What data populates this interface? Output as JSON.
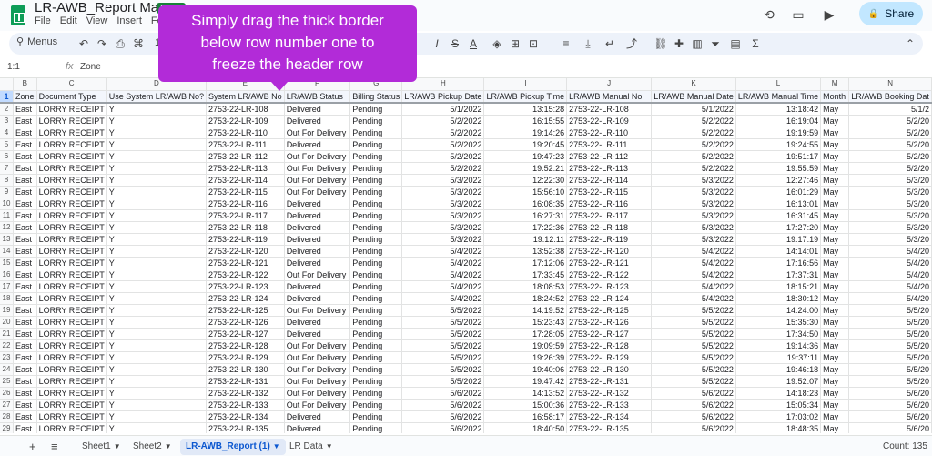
{
  "doc": {
    "title": "LR-AWB_Report May-22",
    "badge": "XLSX",
    "menus": [
      "File",
      "Edit",
      "View",
      "Insert",
      "Form"
    ]
  },
  "share_label": "Share",
  "toolbar": {
    "menus_label": "Menus",
    "zoom": "10"
  },
  "formula": {
    "cell_ref": "1:1",
    "fx": "fx",
    "value": "Zone"
  },
  "callout": {
    "line1": "Simply drag the thick border",
    "line2": "below row number one to",
    "line3": "freeze the header row"
  },
  "columns": [
    "B",
    "C",
    "D",
    "E",
    "F",
    "G",
    "H",
    "I",
    "J",
    "K",
    "L",
    "M",
    "N"
  ],
  "header_row": [
    "Zone",
    "Document Type",
    "Use System LR/AWB No?",
    "System LR/AWB No",
    "LR/AWB Status",
    "Billing Status",
    "LR/AWB Pickup Date",
    "LR/AWB Pickup Time",
    "LR/AWB Manual No",
    "LR/AWB Manual Date",
    "LR/AWB Manual Time",
    "Month",
    "LR/AWB Booking Dat"
  ],
  "rows": [
    [
      "East",
      "LORRY RECEIPT",
      "Y",
      "2753-22-LR-108",
      "Delivered",
      "Pending",
      "5/1/2022",
      "13:15:28",
      "2753-22-LR-108",
      "5/1/2022",
      "13:18:42",
      "May",
      "5/1/2"
    ],
    [
      "East",
      "LORRY RECEIPT",
      "Y",
      "2753-22-LR-109",
      "Delivered",
      "Pending",
      "5/2/2022",
      "16:15:55",
      "2753-22-LR-109",
      "5/2/2022",
      "16:19:04",
      "May",
      "5/2/20"
    ],
    [
      "East",
      "LORRY RECEIPT",
      "Y",
      "2753-22-LR-110",
      "Out For Delivery",
      "Pending",
      "5/2/2022",
      "19:14:26",
      "2753-22-LR-110",
      "5/2/2022",
      "19:19:59",
      "May",
      "5/2/20"
    ],
    [
      "East",
      "LORRY RECEIPT",
      "Y",
      "2753-22-LR-111",
      "Delivered",
      "Pending",
      "5/2/2022",
      "19:20:45",
      "2753-22-LR-111",
      "5/2/2022",
      "19:24:55",
      "May",
      "5/2/20"
    ],
    [
      "East",
      "LORRY RECEIPT",
      "Y",
      "2753-22-LR-112",
      "Out For Delivery",
      "Pending",
      "5/2/2022",
      "19:47:23",
      "2753-22-LR-112",
      "5/2/2022",
      "19:51:17",
      "May",
      "5/2/20"
    ],
    [
      "East",
      "LORRY RECEIPT",
      "Y",
      "2753-22-LR-113",
      "Out For Delivery",
      "Pending",
      "5/2/2022",
      "19:52:21",
      "2753-22-LR-113",
      "5/2/2022",
      "19:55:59",
      "May",
      "5/2/20"
    ],
    [
      "East",
      "LORRY RECEIPT",
      "Y",
      "2753-22-LR-114",
      "Out For Delivery",
      "Pending",
      "5/3/2022",
      "12:22:30",
      "2753-22-LR-114",
      "5/3/2022",
      "12:27:46",
      "May",
      "5/3/20"
    ],
    [
      "East",
      "LORRY RECEIPT",
      "Y",
      "2753-22-LR-115",
      "Out For Delivery",
      "Pending",
      "5/3/2022",
      "15:56:10",
      "2753-22-LR-115",
      "5/3/2022",
      "16:01:29",
      "May",
      "5/3/20"
    ],
    [
      "East",
      "LORRY RECEIPT",
      "Y",
      "2753-22-LR-116",
      "Delivered",
      "Pending",
      "5/3/2022",
      "16:08:35",
      "2753-22-LR-116",
      "5/3/2022",
      "16:13:01",
      "May",
      "5/3/20"
    ],
    [
      "East",
      "LORRY RECEIPT",
      "Y",
      "2753-22-LR-117",
      "Delivered",
      "Pending",
      "5/3/2022",
      "16:27:31",
      "2753-22-LR-117",
      "5/3/2022",
      "16:31:45",
      "May",
      "5/3/20"
    ],
    [
      "East",
      "LORRY RECEIPT",
      "Y",
      "2753-22-LR-118",
      "Delivered",
      "Pending",
      "5/3/2022",
      "17:22:36",
      "2753-22-LR-118",
      "5/3/2022",
      "17:27:20",
      "May",
      "5/3/20"
    ],
    [
      "East",
      "LORRY RECEIPT",
      "Y",
      "2753-22-LR-119",
      "Delivered",
      "Pending",
      "5/3/2022",
      "19:12:11",
      "2753-22-LR-119",
      "5/3/2022",
      "19:17:19",
      "May",
      "5/3/20"
    ],
    [
      "East",
      "LORRY RECEIPT",
      "Y",
      "2753-22-LR-120",
      "Delivered",
      "Pending",
      "5/4/2022",
      "13:52:38",
      "2753-22-LR-120",
      "5/4/2022",
      "14:14:01",
      "May",
      "5/4/20"
    ],
    [
      "East",
      "LORRY RECEIPT",
      "Y",
      "2753-22-LR-121",
      "Delivered",
      "Pending",
      "5/4/2022",
      "17:12:06",
      "2753-22-LR-121",
      "5/4/2022",
      "17:16:56",
      "May",
      "5/4/20"
    ],
    [
      "East",
      "LORRY RECEIPT",
      "Y",
      "2753-22-LR-122",
      "Out For Delivery",
      "Pending",
      "5/4/2022",
      "17:33:45",
      "2753-22-LR-122",
      "5/4/2022",
      "17:37:31",
      "May",
      "5/4/20"
    ],
    [
      "East",
      "LORRY RECEIPT",
      "Y",
      "2753-22-LR-123",
      "Delivered",
      "Pending",
      "5/4/2022",
      "18:08:53",
      "2753-22-LR-123",
      "5/4/2022",
      "18:15:21",
      "May",
      "5/4/20"
    ],
    [
      "East",
      "LORRY RECEIPT",
      "Y",
      "2753-22-LR-124",
      "Delivered",
      "Pending",
      "5/4/2022",
      "18:24:52",
      "2753-22-LR-124",
      "5/4/2022",
      "18:30:12",
      "May",
      "5/4/20"
    ],
    [
      "East",
      "LORRY RECEIPT",
      "Y",
      "2753-22-LR-125",
      "Out For Delivery",
      "Pending",
      "5/5/2022",
      "14:19:52",
      "2753-22-LR-125",
      "5/5/2022",
      "14:24:00",
      "May",
      "5/5/20"
    ],
    [
      "East",
      "LORRY RECEIPT",
      "Y",
      "2753-22-LR-126",
      "Delivered",
      "Pending",
      "5/5/2022",
      "15:23:43",
      "2753-22-LR-126",
      "5/5/2022",
      "15:35:30",
      "May",
      "5/5/20"
    ],
    [
      "East",
      "LORRY RECEIPT",
      "Y",
      "2753-22-LR-127",
      "Delivered",
      "Pending",
      "5/5/2022",
      "17:28:05",
      "2753-22-LR-127",
      "5/5/2022",
      "17:34:50",
      "May",
      "5/5/20"
    ],
    [
      "East",
      "LORRY RECEIPT",
      "Y",
      "2753-22-LR-128",
      "Out For Delivery",
      "Pending",
      "5/5/2022",
      "19:09:59",
      "2753-22-LR-128",
      "5/5/2022",
      "19:14:36",
      "May",
      "5/5/20"
    ],
    [
      "East",
      "LORRY RECEIPT",
      "Y",
      "2753-22-LR-129",
      "Out For Delivery",
      "Pending",
      "5/5/2022",
      "19:26:39",
      "2753-22-LR-129",
      "5/5/2022",
      "19:37:11",
      "May",
      "5/5/20"
    ],
    [
      "East",
      "LORRY RECEIPT",
      "Y",
      "2753-22-LR-130",
      "Out For Delivery",
      "Pending",
      "5/5/2022",
      "19:40:06",
      "2753-22-LR-130",
      "5/5/2022",
      "19:46:18",
      "May",
      "5/5/20"
    ],
    [
      "East",
      "LORRY RECEIPT",
      "Y",
      "2753-22-LR-131",
      "Out For Delivery",
      "Pending",
      "5/5/2022",
      "19:47:42",
      "2753-22-LR-131",
      "5/5/2022",
      "19:52:07",
      "May",
      "5/5/20"
    ],
    [
      "East",
      "LORRY RECEIPT",
      "Y",
      "2753-22-LR-132",
      "Out For Delivery",
      "Pending",
      "5/6/2022",
      "14:13:52",
      "2753-22-LR-132",
      "5/6/2022",
      "14:18:23",
      "May",
      "5/6/20"
    ],
    [
      "East",
      "LORRY RECEIPT",
      "Y",
      "2753-22-LR-133",
      "Out For Delivery",
      "Pending",
      "5/6/2022",
      "15:00:36",
      "2753-22-LR-133",
      "5/6/2022",
      "15:05:34",
      "May",
      "5/6/20"
    ],
    [
      "East",
      "LORRY RECEIPT",
      "Y",
      "2753-22-LR-134",
      "Delivered",
      "Pending",
      "5/6/2022",
      "16:58:17",
      "2753-22-LR-134",
      "5/6/2022",
      "17:03:02",
      "May",
      "5/6/20"
    ],
    [
      "East",
      "LORRY RECEIPT",
      "Y",
      "2753-22-LR-135",
      "Delivered",
      "Pending",
      "5/6/2022",
      "18:40:50",
      "2753-22-LR-135",
      "5/6/2022",
      "18:48:35",
      "May",
      "5/6/20"
    ]
  ],
  "sheets": [
    "Sheet1",
    "Sheet2",
    "LR-AWB_Report (1)",
    "LR Data"
  ],
  "active_sheet_index": 2,
  "count_label": "Count: 135",
  "colors": {
    "callout": "#b22bd8",
    "active_tab": "#0b57d0",
    "share_bg": "#c2e7ff",
    "sheets_green": "#0f9d58"
  }
}
